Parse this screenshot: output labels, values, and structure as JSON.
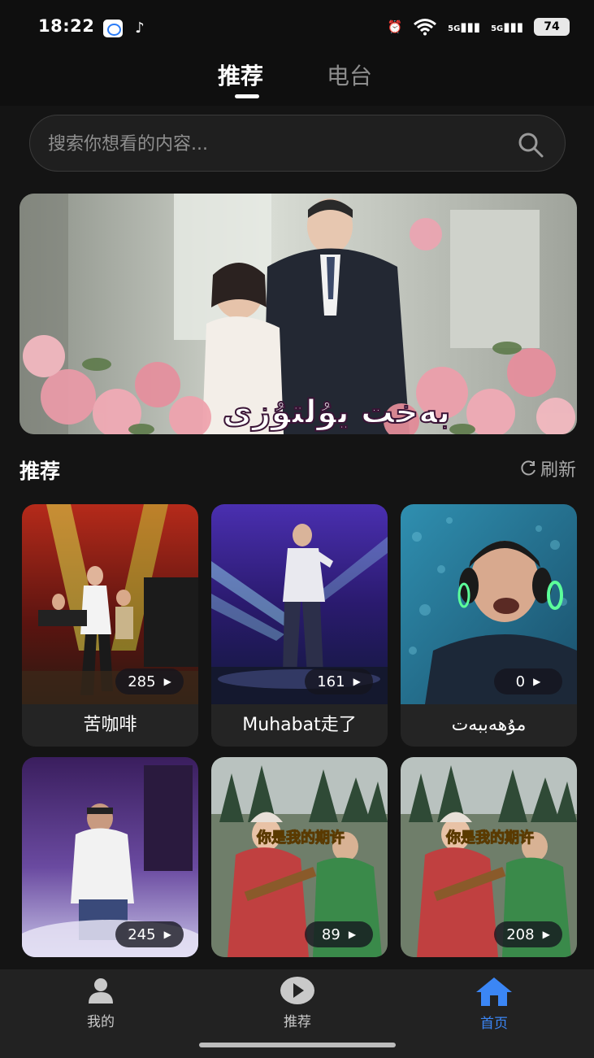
{
  "status_bar": {
    "time": "18:22",
    "signal1": "5G",
    "signal2": "5G",
    "battery": "74"
  },
  "top_tabs": [
    {
      "label": "推荐",
      "active": true
    },
    {
      "label": "电台",
      "active": false
    }
  ],
  "search": {
    "placeholder": "搜索你想看的内容..."
  },
  "banner": {
    "caption": "بەخت يۇلتۇزى"
  },
  "section": {
    "title": "推荐",
    "refresh_label": "刷新"
  },
  "cards": [
    {
      "title": "苦咖啡",
      "count": "285"
    },
    {
      "title": "Muhabat走了",
      "count": "161"
    },
    {
      "title": "مۇھەببەت",
      "count": "0"
    },
    {
      "title": "",
      "count": "245"
    },
    {
      "title": "",
      "count": "89",
      "overlay": "你是我的期许"
    },
    {
      "title": "",
      "count": "208",
      "overlay": "你是我的期许"
    }
  ],
  "bottom_nav": [
    {
      "label": "我的",
      "icon": "person-icon",
      "active": false
    },
    {
      "label": "推荐",
      "icon": "play-circle-icon",
      "active": false
    },
    {
      "label": "首页",
      "icon": "home-icon",
      "active": true
    }
  ],
  "colors": {
    "background": "#141414",
    "accent": "#3b86f5",
    "card": "#242424"
  }
}
